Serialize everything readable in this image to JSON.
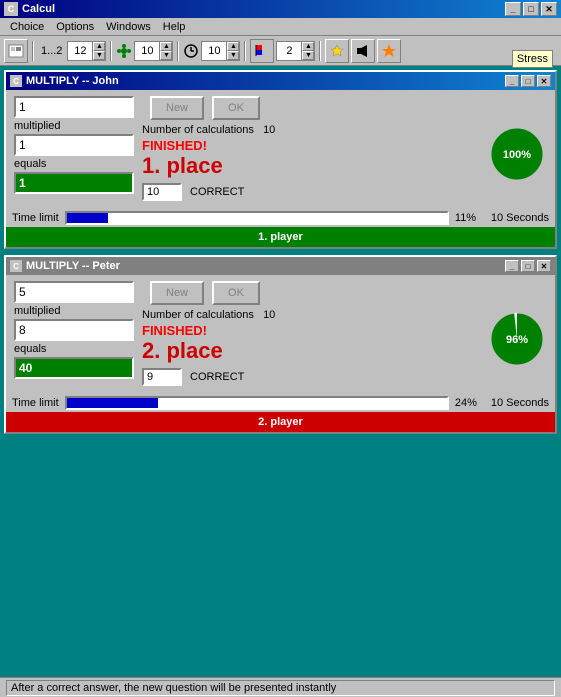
{
  "app": {
    "title": "Calcul",
    "title_icon": "C"
  },
  "menu": {
    "items": [
      "Choice",
      "Options",
      "Windows",
      "Help"
    ]
  },
  "toolbar": {
    "page_val": "1...2",
    "spinner1_val": "12",
    "spinner2_val": "10",
    "spinner3_val": "10",
    "spinner4_val": "2"
  },
  "stress_tooltip": "Stress",
  "window1": {
    "title": "MULTIPLY  --  John",
    "field1": "1",
    "field2": "1",
    "field3_val": "1",
    "field_label1": "multiplied",
    "field_label2": "equals",
    "num_calculations_label": "Number of calculations",
    "num_calculations": "10",
    "finished_text": "FINISHED!",
    "place_text": "1. place",
    "correct_val": "10",
    "correct_label": "CORRECT",
    "new_btn": "New",
    "ok_btn": "OK",
    "time_limit_label": "Time limit",
    "progress_pct": "11%",
    "progress_pct_num": 11,
    "seconds_label": "10 Seconds",
    "player_label": "1. player",
    "pie_pct": "100%",
    "pie_fill": 100
  },
  "window2": {
    "title": "MULTIPLY  --  Peter",
    "field1": "5",
    "field2": "8",
    "field3_val": "40",
    "field_label1": "multiplied",
    "field_label2": "equals",
    "num_calculations_label": "Number of calculations",
    "num_calculations": "10",
    "finished_text": "FINISHED!",
    "place_text": "2. place",
    "correct_val": "9",
    "correct_label": "CORRECT",
    "new_btn": "New",
    "ok_btn": "OK",
    "time_limit_label": "Time limit",
    "progress_pct": "24%",
    "progress_pct_num": 24,
    "seconds_label": "10 Seconds",
    "player_label": "2. player",
    "pie_pct": "96%",
    "pie_fill": 96
  },
  "status_bar": {
    "text": "After a correct answer, the new question will be presented instantly"
  }
}
